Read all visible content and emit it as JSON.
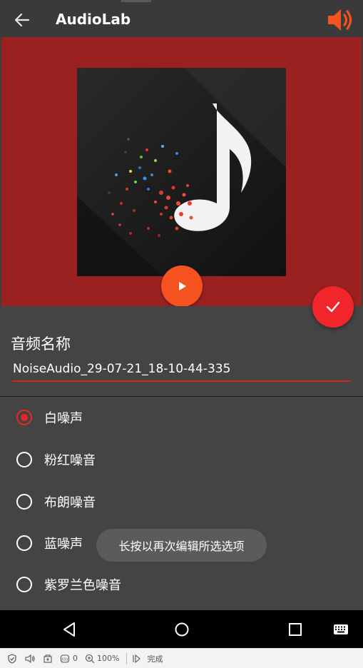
{
  "app": {
    "title": "AudioLab",
    "back_icon": "arrow-left-icon",
    "speaker_icon": "volume-icon",
    "accent_color": "#f4521f"
  },
  "hero": {
    "background_color": "#9b2121",
    "artwork": "music-note-artwork",
    "play_icon": "play-icon",
    "confirm_icon": "checkmark-icon"
  },
  "form": {
    "name_label": "音频名称",
    "name_value": "NoiseAudio_29-07-21_18-10-44-335"
  },
  "options": [
    {
      "label": "白噪声",
      "checked": true
    },
    {
      "label": "粉红噪音",
      "checked": false
    },
    {
      "label": "布朗噪音",
      "checked": false
    },
    {
      "label": "蓝噪声",
      "checked": false
    },
    {
      "label": "紫罗兰色噪音",
      "checked": false
    }
  ],
  "toast": {
    "text": "长按以再次编辑所选选项"
  },
  "navbar": {
    "back": "triangle-back-icon",
    "home": "circle-home-icon",
    "recents": "square-recents-icon",
    "keyboard": "keyboard-icon"
  },
  "statusbar": {
    "counter_value": "0",
    "zoom_value": "100%",
    "status_text": "完成"
  }
}
